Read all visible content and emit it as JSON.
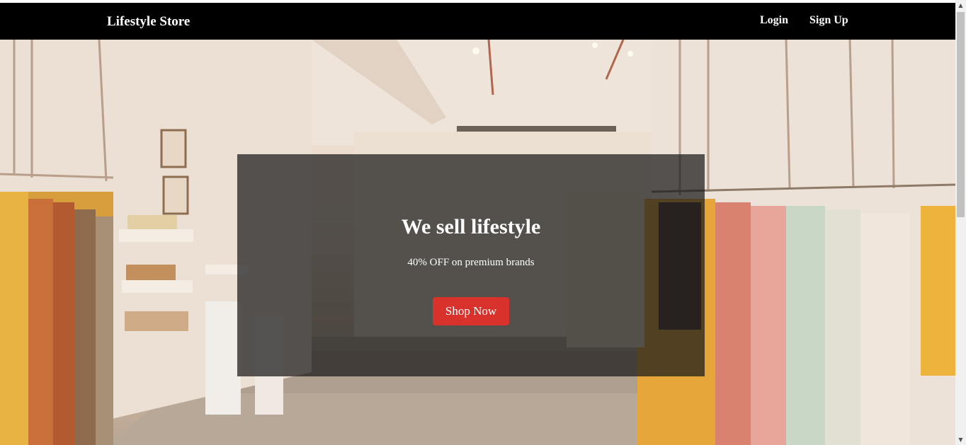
{
  "navbar": {
    "brand": "Lifestyle Store",
    "links": {
      "login": "Login",
      "signup": "Sign Up"
    },
    "background": "#000000"
  },
  "hero": {
    "headline": "We sell lifestyle",
    "subheadline": "40% OFF on premium brands",
    "cta_label": "Shop Now",
    "cta_color": "#d9312b",
    "background_description_icon": "boutique-interior-image"
  },
  "scrollbar": {
    "up_icon": "▲",
    "down_icon": "▼"
  }
}
